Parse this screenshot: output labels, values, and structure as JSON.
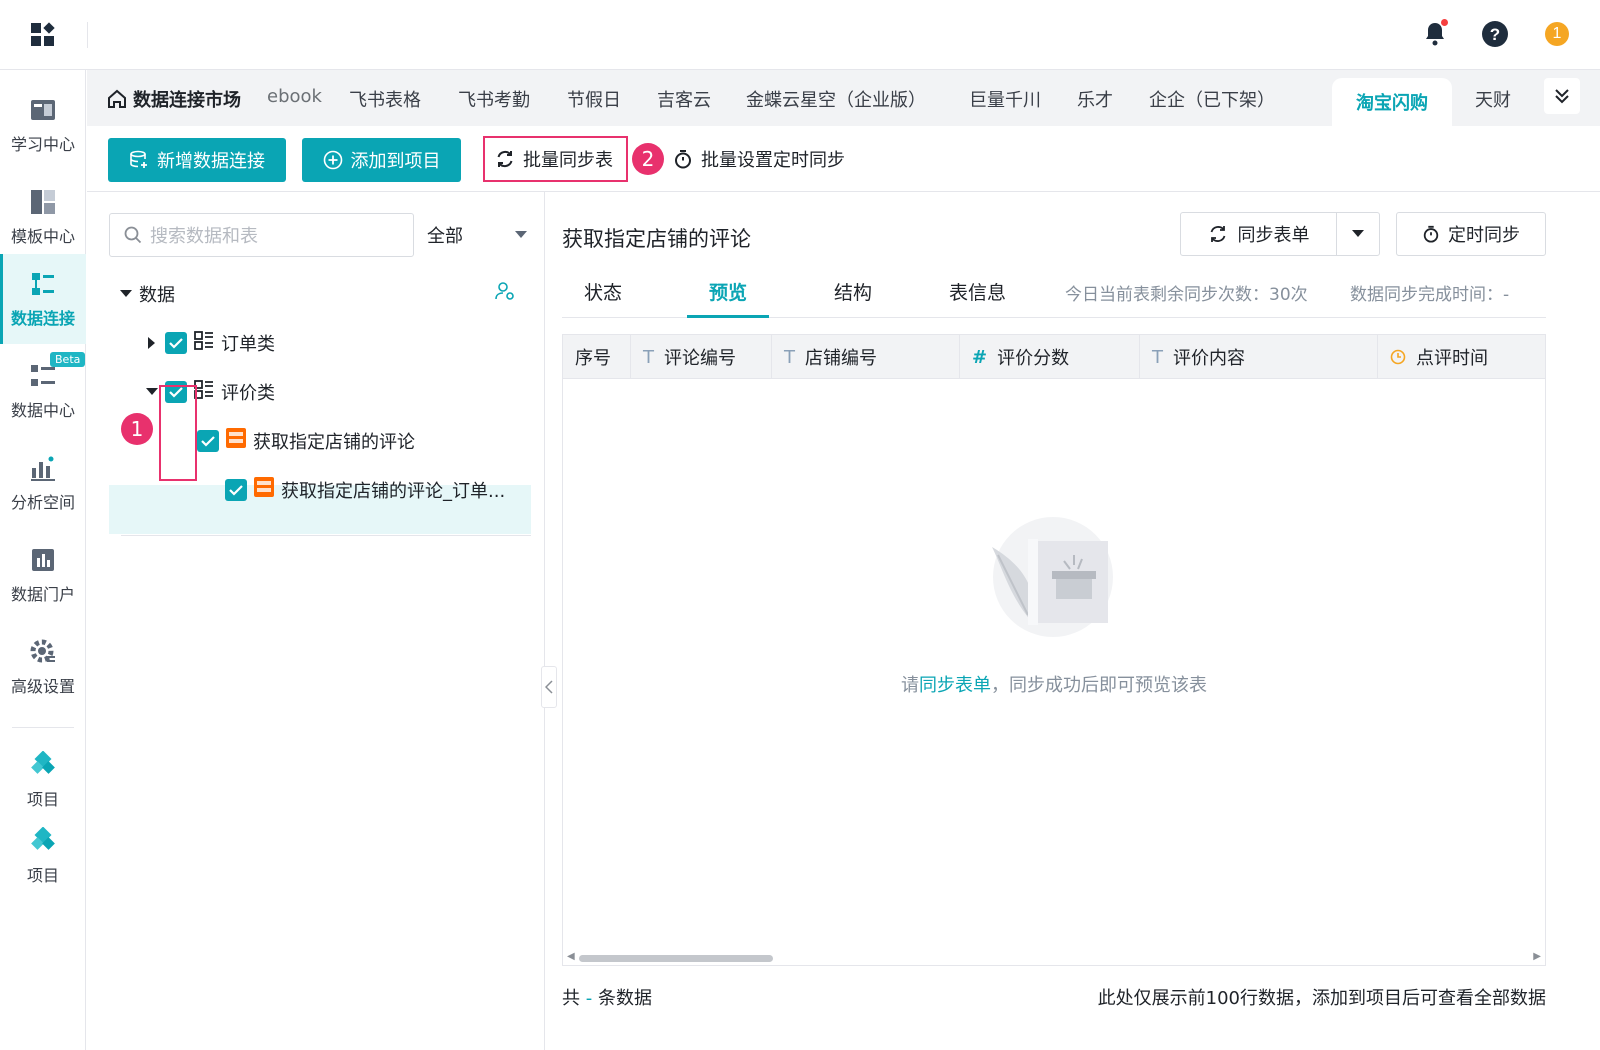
{
  "topbar": {
    "logo_icon": "apps-grid-icon",
    "bell_icon": "bell-icon",
    "help_icon": "help-circle-icon",
    "user_badge": "1",
    "accent_color": "#0aa5b4",
    "highlight_color": "#e8316d"
  },
  "sidebar": {
    "items": [
      {
        "label": "学习中心",
        "icon": "book-icon"
      },
      {
        "label": "模板中心",
        "icon": "template-icon"
      },
      {
        "label": "数据连接",
        "icon": "data-connect-icon"
      },
      {
        "label": "数据中心",
        "icon": "data-center-icon",
        "badge": "Beta"
      },
      {
        "label": "分析空间",
        "icon": "analysis-icon"
      },
      {
        "label": "数据门户",
        "icon": "portal-icon"
      },
      {
        "label": "高级设置",
        "icon": "gear-icon"
      },
      {
        "label": "项目",
        "icon": "project-icon"
      },
      {
        "label": "项目",
        "icon": "project-icon"
      }
    ]
  },
  "tabs": {
    "home": "数据连接市场",
    "items": [
      "ebook",
      "飞书表格",
      "飞书考勤",
      "节假日",
      "吉客云",
      "金蝶云星空（企业版）",
      "巨量千川",
      "乐才",
      "企企（已下架）"
    ],
    "active": "淘宝闪购",
    "after": "天财"
  },
  "toolbar": {
    "new_connection": "新增数据连接",
    "add_to_project": "添加到项目",
    "batch_sync": "批量同步表",
    "batch_schedule": "批量设置定时同步",
    "step1": "1",
    "step2": "2"
  },
  "left": {
    "search_placeholder": "搜索数据和表",
    "filter": "全部",
    "root": "数据",
    "groups": [
      "订单类",
      "评价类"
    ],
    "tables": [
      "获取指定店铺的评论",
      "获取指定店铺的评论_订单..."
    ]
  },
  "right": {
    "title": "获取指定店铺的评论",
    "sync_btn": "同步表单",
    "schedule_btn": "定时同步",
    "tabs": [
      "状态",
      "预览",
      "结构",
      "表信息"
    ],
    "active_tab": "预览",
    "remaining": "今日当前表剩余同步次数：30次",
    "done_time": "数据同步完成时间：-",
    "columns": [
      {
        "type": "",
        "name": "序号"
      },
      {
        "type": "T",
        "name": "评论编号"
      },
      {
        "type": "T",
        "name": "店铺编号"
      },
      {
        "type": "#",
        "name": "评价分数"
      },
      {
        "type": "T",
        "name": "评价内容"
      },
      {
        "type": "clock",
        "name": "点评时间"
      }
    ],
    "empty_prefix": "请",
    "empty_link": "同步表单",
    "empty_suffix": "，同步成功后即可预览该表",
    "footer_left_prefix": "共",
    "footer_left_count": "-",
    "footer_left_suffix": "条数据",
    "footer_right": "此处仅展示前100行数据，添加到项目后可查看全部数据"
  }
}
